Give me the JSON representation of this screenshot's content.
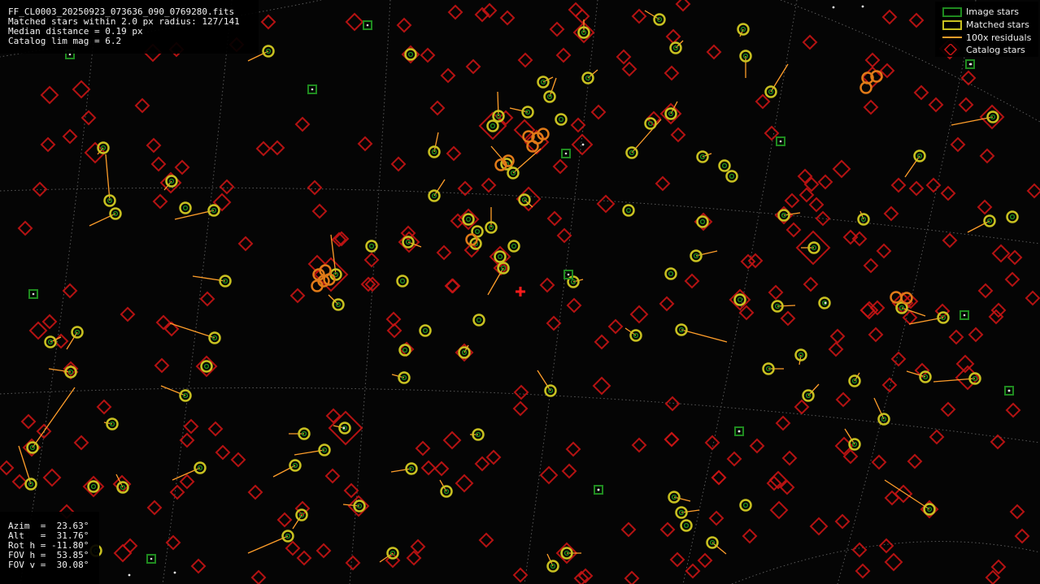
{
  "info": {
    "filename": "FF_CL0003_20250923_073636_090_0769280.fits",
    "matched": "Matched stars within 2.0 px radius: 127/141",
    "median": "Median distance = 0.19 px",
    "limmag": "Catalog lim mag = 6.2"
  },
  "pointing": {
    "azim": "Azim  =  23.63°",
    "alt": "Alt   =  31.76°",
    "rot": "Rot h = -11.80°",
    "fovh": "FOV h =  53.85°",
    "fovv": "FOV v =  30.08°"
  },
  "legend": {
    "image_stars": "Image stars",
    "matched_stars": "Matched stars",
    "residuals": "100x residuals",
    "catalog_stars": "Catalog stars"
  },
  "colors": {
    "image_star": "#1f8a1f",
    "matched_star": "#c8c020",
    "residual": "#ff9e2a",
    "catalog_star": "#c81414",
    "grid": "#6a6a6a",
    "center_marker": "#ff1a1a"
  },
  "icons": {
    "center_marker": "red-cross-icon"
  }
}
